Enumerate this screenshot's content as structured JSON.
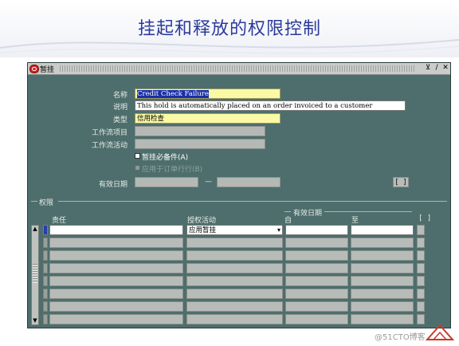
{
  "slide": {
    "title": "挂起和释放的权限控制"
  },
  "window": {
    "title": "暂挂",
    "buttons": [
      "⊻",
      "∕",
      "✕"
    ]
  },
  "form": {
    "name": {
      "label": "名称",
      "value": "Credit Check Failure"
    },
    "description": {
      "label": "说明",
      "value": "This hold is automatically placed on an order invoiced to a customer"
    },
    "type": {
      "label": "类型",
      "value": "信用检查"
    },
    "workflow_item": {
      "label": "工作流项目",
      "value": ""
    },
    "workflow_activity": {
      "label": "工作流活动",
      "value": ""
    },
    "hold_included_items": {
      "label": "暂挂必备件(A)",
      "checked": true
    },
    "apply_to_order_lines": {
      "label": "应用于订单行行(B)",
      "checked": false
    },
    "effective_dates": {
      "label": "有效日期",
      "from": "",
      "dash": "—",
      "to": "",
      "bracket_button": "[ ]"
    }
  },
  "authority": {
    "section_label": "权限",
    "columns": {
      "responsibility": "责任",
      "authorized_action": "授权活动",
      "effective_dates_group": "有效日期",
      "from": "自",
      "to": "至",
      "flex": "[ ]"
    },
    "rows": [
      {
        "responsibility": "",
        "action": "应用暂挂",
        "from": "",
        "to": ""
      },
      {
        "responsibility": "",
        "action": "",
        "from": "",
        "to": ""
      },
      {
        "responsibility": "",
        "action": "",
        "from": "",
        "to": ""
      },
      {
        "responsibility": "",
        "action": "",
        "from": "",
        "to": ""
      },
      {
        "responsibility": "",
        "action": "",
        "from": "",
        "to": ""
      },
      {
        "responsibility": "",
        "action": "",
        "from": "",
        "to": ""
      },
      {
        "responsibility": "",
        "action": "",
        "from": "",
        "to": ""
      },
      {
        "responsibility": "",
        "action": "",
        "from": "",
        "to": ""
      }
    ]
  },
  "watermark": "@51CTO博客",
  "colors": {
    "window_bg": "#4d6e6c",
    "title_text": "#2a3a9c",
    "required_field": "#fbf9a6",
    "selection": "#1830a8"
  }
}
